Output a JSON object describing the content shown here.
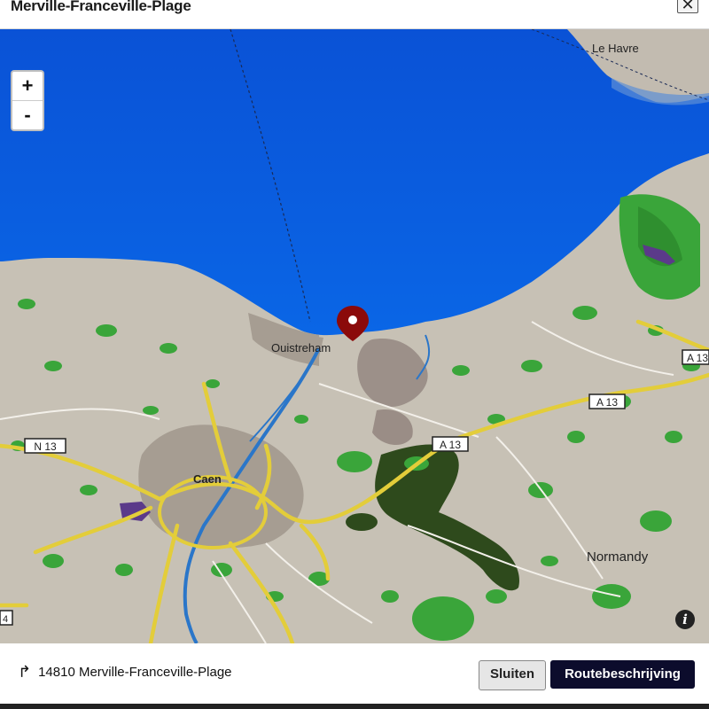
{
  "dialog": {
    "title": "Merville-Franceville-Plage",
    "close_icon": "✕"
  },
  "map": {
    "zoom_in": "+",
    "zoom_out": "-",
    "info_icon": "i",
    "labels": {
      "le_havre": "Le Havre",
      "ouistreham": "Ouistreham",
      "caen": "Caen",
      "normandy": "Normandy"
    },
    "road_shields": {
      "n13": "N 13",
      "a13_center": "A 13",
      "a13_right": "A 13",
      "a13_edge": "A 13",
      "a4_edge": "4"
    },
    "colors": {
      "sea": "#0b57d8",
      "land": "#c9c2b6",
      "urban": "#a9a096",
      "forest": "#3aa53a",
      "dark_forest": "#2d4d1c",
      "motorway": "#e2cc3a",
      "marker": "#8b0000"
    }
  },
  "footer": {
    "route_icon": "↱",
    "address": "14810 Merville-Franceville-Plage",
    "close_label": "Sluiten",
    "route_label": "Routebeschrijving"
  }
}
